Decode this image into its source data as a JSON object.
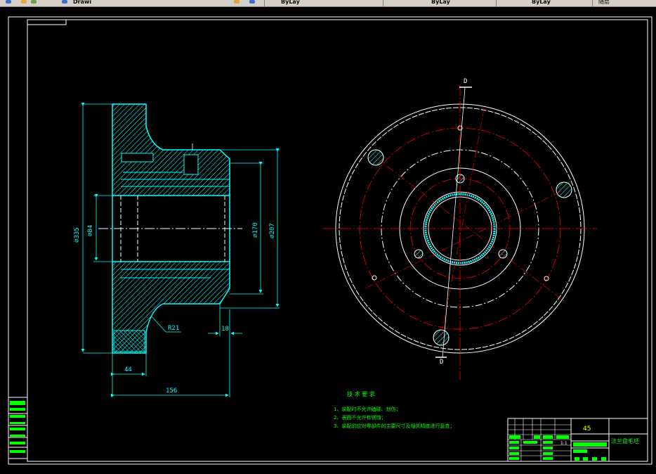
{
  "toolbar": {
    "tab_1": "Drawi",
    "tab_2": "ByLay",
    "tab_3": "ByLay",
    "tab_4": "ByLay",
    "tab_5": "随层"
  },
  "drawing": {
    "dimensions": {
      "d335": "⌀335",
      "d84": "⌀84",
      "d170": "⌀170",
      "d207": "⌀207",
      "r21": "R21",
      "len18": "18",
      "len44": "44",
      "len156": "156"
    },
    "section_mark": "D",
    "section_mark_2": "D",
    "notes_title": "技 术 要 求",
    "notes": [
      "1、装配时不允许磕碰、划伤；",
      "2、表面不允许有锈蚀；",
      "3、装配前应对零部件的主要尺寸及相关精度进行复查；"
    ],
    "title_block": {
      "material": "45",
      "part_name": "法兰盘毛坯",
      "scale": "1:1"
    }
  },
  "colors": {
    "background": "#000000",
    "border": "#ffffff",
    "geometry": "#00ffff",
    "centerline": "#ff0000",
    "hidden": "#ffffff",
    "hatch": "#00ffff",
    "annotation": "#00ff00",
    "title": "#ffff00"
  }
}
